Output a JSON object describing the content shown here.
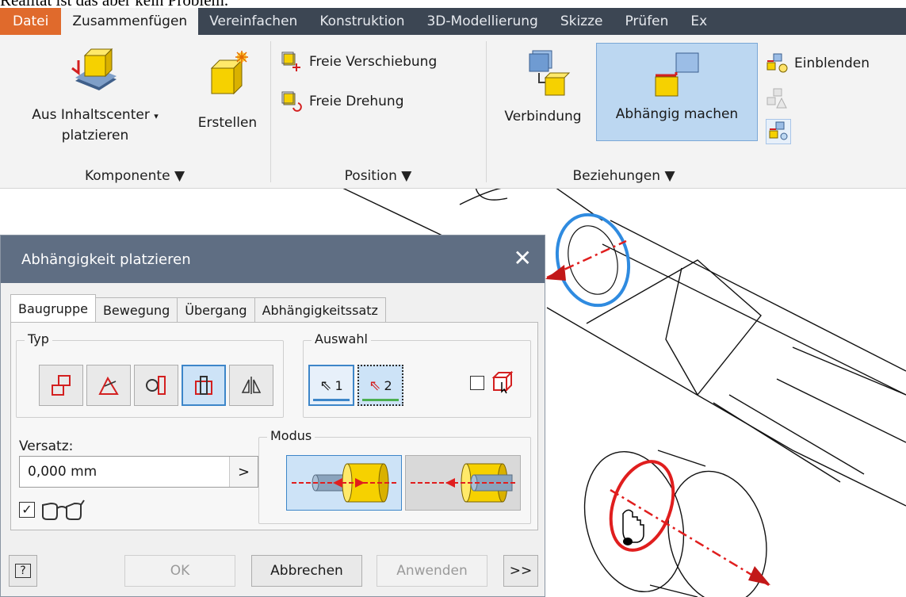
{
  "top_text": "Realität ist das aber kein Problem.",
  "ribbon_tabs": [
    {
      "label": "Datei"
    },
    {
      "label": "Zusammenfügen"
    },
    {
      "label": "Vereinfachen"
    },
    {
      "label": "Konstruktion"
    },
    {
      "label": "3D-Modellierung"
    },
    {
      "label": "Skizze"
    },
    {
      "label": "Prüfen"
    },
    {
      "label": "Ex"
    }
  ],
  "komponente": {
    "place_label_1": "Aus Inhaltscenter",
    "place_label_2": "platzieren",
    "create_label": "Erstellen",
    "group_label": "Komponente ▼"
  },
  "position": {
    "free_move": "Freie Verschiebung",
    "free_rotate": "Freie Drehung",
    "group_label": "Position ▼"
  },
  "beziehungen": {
    "joint": "Verbindung",
    "constrain": "Abhängig machen",
    "show": "Einblenden",
    "group_label": "Beziehungen ▼"
  },
  "dialog": {
    "title": "Abhängigkeit platzieren",
    "close_glyph": "✕",
    "tabs": [
      {
        "label": "Baugruppe"
      },
      {
        "label": "Bewegung"
      },
      {
        "label": "Übergang"
      },
      {
        "label": "Abhängigkeitssatz"
      }
    ],
    "typ_label": "Typ",
    "auswahl_label": "Auswahl",
    "sel1": "1",
    "sel2": "2",
    "versatz_label": "Versatz:",
    "versatz_value": "0,000 mm",
    "arrow_glyph": ">",
    "modus_label": "Modus",
    "ok": "OK",
    "cancel": "Abbrechen",
    "apply": "Anwenden",
    "more": ">>",
    "help": "?"
  },
  "colors": {
    "tabbar": "#3c4653",
    "file_tab": "#e06a2c",
    "dialog_title": "#5f6e83",
    "selected_blue": "#bcd7f1",
    "constraint_red": "#e01e1e",
    "highlight_blue": "#2f8be0"
  }
}
